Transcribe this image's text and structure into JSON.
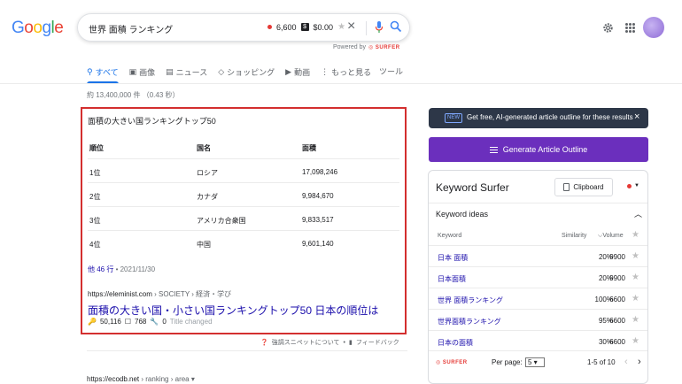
{
  "logo": {
    "letters": [
      "G",
      "o",
      "o",
      "g",
      "l",
      "e"
    ],
    "colors": [
      "#4285f4",
      "#ea4335",
      "#fbbc05",
      "#4285f4",
      "#34a853",
      "#ea4335"
    ]
  },
  "search": {
    "query": "世界 面積 ランキング",
    "volume": "6,600",
    "cpc": "$0.00",
    "powered_by": "Powered by",
    "surfer": "SURFER"
  },
  "tabs": [
    {
      "icon": "search-icon",
      "label": "すべて"
    },
    {
      "icon": "image-icon",
      "label": "画像"
    },
    {
      "icon": "news-icon",
      "label": "ニュース"
    },
    {
      "icon": "shopping-icon",
      "label": "ショッピング"
    },
    {
      "icon": "video-icon",
      "label": "動画"
    },
    {
      "icon": "more-icon",
      "label": "もっと見る"
    }
  ],
  "tools_label": "ツール",
  "result_stats": "約 13,400,000 件 （0.43 秒）",
  "snippet": {
    "title": "面積の大きい国ランキングトップ50",
    "headers": [
      "順位",
      "国名",
      "面積"
    ],
    "rows": [
      [
        "1位",
        "ロシア",
        "17,098,246"
      ],
      [
        "2位",
        "カナダ",
        "9,984,670"
      ],
      [
        "3位",
        "アメリカ合衆国",
        "9,833,517"
      ],
      [
        "4位",
        "中国",
        "9,601,140"
      ]
    ],
    "more_rows": "他 46 行",
    "date": " • 2021/11/30",
    "cite_domain": "https://eleminist.com",
    "cite_path": " › SOCIETY › 経済・学び",
    "link_title": "面積の大きい国・小さい国ランキングトップ50 日本の順位は",
    "ks_count": "50,116",
    "ks_links": "768",
    "ks_zero": "0",
    "ks_changed": "Title changed"
  },
  "feedback": {
    "about": "強調スニペットについて",
    "feedback": "フィードバック"
  },
  "next_cite": {
    "domain": "https://ecodb.net",
    "path": " › ranking › area"
  },
  "promo": {
    "badge": "NEW",
    "text": "Get free, AI-generated article outline for these results",
    "close": "×"
  },
  "generate_button": "Generate Article Outline",
  "ks_panel": {
    "title": "Keyword Surfer",
    "clipboard": "Clipboard",
    "keyword_ideas": "Keyword ideas",
    "col_keyword": "Keyword",
    "col_similarity": "Similarity",
    "col_volume": "Volume",
    "rows": [
      {
        "keyword": "日本 面積",
        "similarity": "20%",
        "volume": "9900"
      },
      {
        "keyword": "日本面積",
        "similarity": "20%",
        "volume": "9900"
      },
      {
        "keyword": "世界 面積ランキング",
        "similarity": "100%",
        "volume": "6600"
      },
      {
        "keyword": "世界面積ランキング",
        "similarity": "95%",
        "volume": "6600"
      },
      {
        "keyword": "日本の面積",
        "similarity": "30%",
        "volume": "6600"
      }
    ],
    "surfer": "SURFER",
    "per_page_label": "Per page:",
    "per_page_value": "5",
    "range": "1-5 of 10"
  }
}
